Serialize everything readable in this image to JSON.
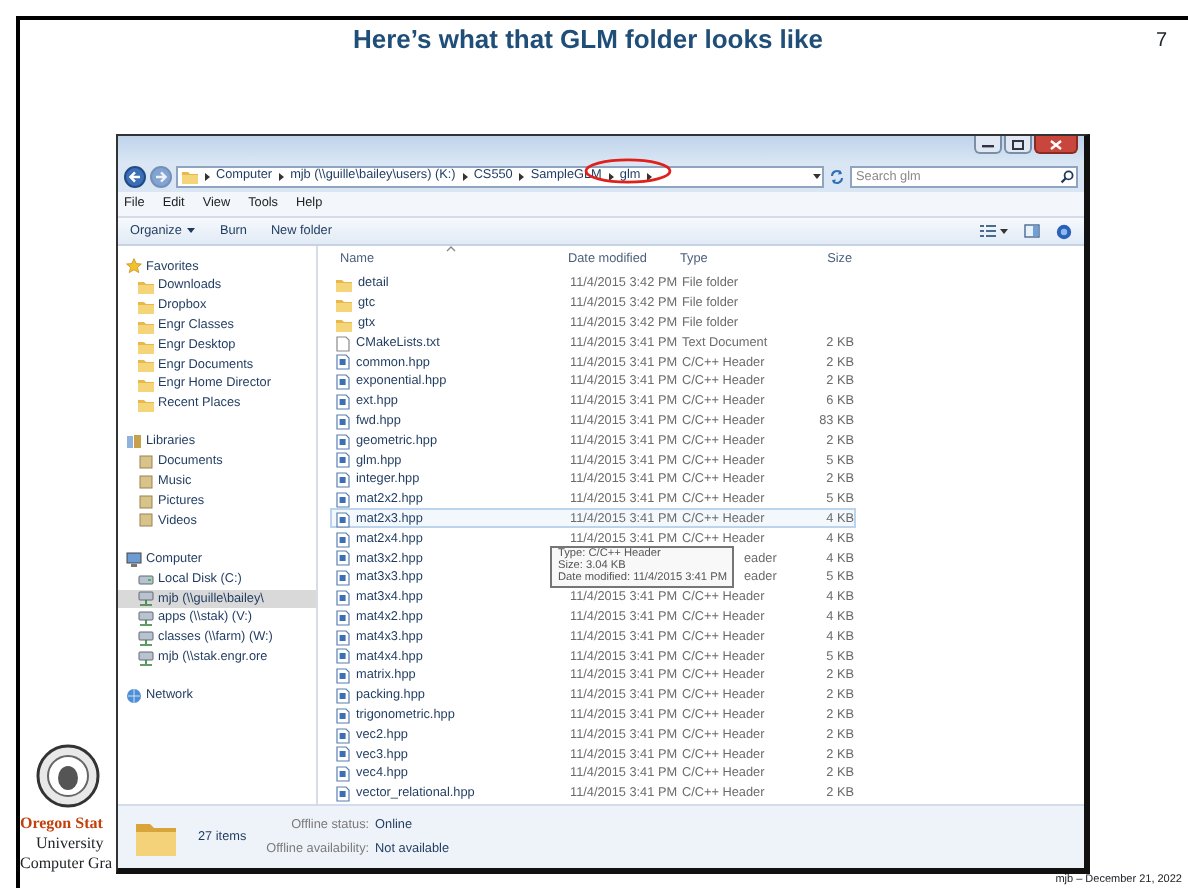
{
  "slide": {
    "title": "Here’s what that GLM folder looks like",
    "page_number": "7",
    "logo_lines": [
      "Oregon Stat",
      "University",
      "Computer Gra"
    ],
    "footer": "mjb – December 21, 2022"
  },
  "explorer": {
    "breadcrumbs": [
      {
        "label": "Computer",
        "circled": false
      },
      {
        "label": "mjb (\\\\guille\\bailey\\users) (K:)",
        "circled": false
      },
      {
        "label": "CS550",
        "circled": false
      },
      {
        "label": "SampleGLM",
        "circled": false
      },
      {
        "label": "glm",
        "circled": true
      }
    ],
    "search": {
      "placeholder": "Search glm"
    },
    "menu": [
      "File",
      "Edit",
      "View",
      "Tools",
      "Help"
    ],
    "toolbar": [
      {
        "label": "Organize",
        "dropdown": true
      },
      {
        "label": "Burn",
        "dropdown": false
      },
      {
        "label": "New folder",
        "dropdown": false
      }
    ],
    "sidebar": [
      {
        "label": "Favorites",
        "kind": "favorites",
        "items": [
          {
            "label": "Downloads",
            "kind": "folder",
            "selected": false
          },
          {
            "label": "Dropbox",
            "kind": "folder",
            "selected": false
          },
          {
            "label": "Engr Classes",
            "kind": "folder",
            "selected": false
          },
          {
            "label": "Engr Desktop",
            "kind": "folder",
            "selected": false
          },
          {
            "label": "Engr Documents",
            "kind": "folder",
            "selected": false
          },
          {
            "label": "Engr Home Director",
            "kind": "folder",
            "selected": false
          },
          {
            "label": "Recent Places",
            "kind": "folder",
            "selected": false
          }
        ]
      },
      {
        "label": "Libraries",
        "kind": "libraries",
        "items": [
          {
            "label": "Documents",
            "kind": "library",
            "selected": false
          },
          {
            "label": "Music",
            "kind": "library",
            "selected": false
          },
          {
            "label": "Pictures",
            "kind": "library",
            "selected": false
          },
          {
            "label": "Videos",
            "kind": "library",
            "selected": false
          }
        ]
      },
      {
        "label": "Computer",
        "kind": "computer",
        "items": [
          {
            "label": "Local Disk (C:)",
            "kind": "drive",
            "selected": false
          },
          {
            "label": "mjb (\\\\guille\\bailey\\",
            "kind": "netdrive",
            "selected": true
          },
          {
            "label": "apps (\\\\stak) (V:)",
            "kind": "netdrive",
            "selected": false
          },
          {
            "label": "classes (\\\\farm) (W:)",
            "kind": "netdrive",
            "selected": false
          },
          {
            "label": "mjb (\\\\stak.engr.ore",
            "kind": "netdrive",
            "selected": false
          }
        ]
      },
      {
        "label": "Network",
        "kind": "network"
      }
    ],
    "columns": [
      "Name",
      "Date modified",
      "Type",
      "Size"
    ],
    "files": [
      {
        "name": "detail",
        "date": "11/4/2015 3:42 PM",
        "type": "File folder",
        "kind": "folder",
        "hovered": false
      },
      {
        "name": "gtc",
        "date": "11/4/2015 3:42 PM",
        "type": "File folder",
        "kind": "folder",
        "hovered": false
      },
      {
        "name": "gtx",
        "date": "11/4/2015 3:42 PM",
        "type": "File folder",
        "kind": "folder",
        "hovered": false
      },
      {
        "name": "CMakeLists.txt",
        "date": "11/4/2015 3:41 PM",
        "type": "Text Document",
        "size": "2 KB",
        "kind": "text",
        "hovered": false
      },
      {
        "name": "common.hpp",
        "date": "11/4/2015 3:41 PM",
        "type": "C/C++ Header",
        "size": "2 KB",
        "kind": "header",
        "hovered": false
      },
      {
        "name": "exponential.hpp",
        "date": "11/4/2015 3:41 PM",
        "type": "C/C++ Header",
        "size": "2 KB",
        "kind": "header",
        "hovered": false
      },
      {
        "name": "ext.hpp",
        "date": "11/4/2015 3:41 PM",
        "type": "C/C++ Header",
        "size": "6 KB",
        "kind": "header",
        "hovered": false
      },
      {
        "name": "fwd.hpp",
        "date": "11/4/2015 3:41 PM",
        "type": "C/C++ Header",
        "size": "83 KB",
        "kind": "header",
        "hovered": false
      },
      {
        "name": "geometric.hpp",
        "date": "11/4/2015 3:41 PM",
        "type": "C/C++ Header",
        "size": "2 KB",
        "kind": "header",
        "hovered": false
      },
      {
        "name": "glm.hpp",
        "date": "11/4/2015 3:41 PM",
        "type": "C/C++ Header",
        "size": "5 KB",
        "kind": "header",
        "hovered": false
      },
      {
        "name": "integer.hpp",
        "date": "11/4/2015 3:41 PM",
        "type": "C/C++ Header",
        "size": "2 KB",
        "kind": "header",
        "hovered": false
      },
      {
        "name": "mat2x2.hpp",
        "date": "11/4/2015 3:41 PM",
        "type": "C/C++ Header",
        "size": "5 KB",
        "kind": "header",
        "hovered": false
      },
      {
        "name": "mat2x3.hpp",
        "date": "11/4/2015 3:41 PM",
        "type": "C/C++ Header",
        "size": "4 KB",
        "kind": "header",
        "hovered": true
      },
      {
        "name": "mat2x4.hpp",
        "date": "11/4/2015 3:41 PM",
        "type": "C/C++ Header",
        "size": "4 KB",
        "kind": "header",
        "hovered": false
      },
      {
        "name": "mat3x2.hpp",
        "type": "eader",
        "size": "4 KB",
        "kind": "header",
        "hovered": false
      },
      {
        "name": "mat3x3.hpp",
        "type": "eader",
        "size": "5 KB",
        "kind": "header",
        "hovered": false
      },
      {
        "name": "mat3x4.hpp",
        "date": "11/4/2015 3:41 PM",
        "type": "C/C++ Header",
        "size": "4 KB",
        "kind": "header",
        "hovered": false
      },
      {
        "name": "mat4x2.hpp",
        "date": "11/4/2015 3:41 PM",
        "type": "C/C++ Header",
        "size": "4 KB",
        "kind": "header",
        "hovered": false
      },
      {
        "name": "mat4x3.hpp",
        "date": "11/4/2015 3:41 PM",
        "type": "C/C++ Header",
        "size": "4 KB",
        "kind": "header",
        "hovered": false
      },
      {
        "name": "mat4x4.hpp",
        "date": "11/4/2015 3:41 PM",
        "type": "C/C++ Header",
        "size": "5 KB",
        "kind": "header",
        "hovered": false
      },
      {
        "name": "matrix.hpp",
        "date": "11/4/2015 3:41 PM",
        "type": "C/C++ Header",
        "size": "2 KB",
        "kind": "header",
        "hovered": false
      },
      {
        "name": "packing.hpp",
        "date": "11/4/2015 3:41 PM",
        "type": "C/C++ Header",
        "size": "2 KB",
        "kind": "header",
        "hovered": false
      },
      {
        "name": "trigonometric.hpp",
        "date": "11/4/2015 3:41 PM",
        "type": "C/C++ Header",
        "size": "2 KB",
        "kind": "header",
        "hovered": false
      },
      {
        "name": "vec2.hpp",
        "date": "11/4/2015 3:41 PM",
        "type": "C/C++ Header",
        "size": "2 KB",
        "kind": "header",
        "hovered": false
      },
      {
        "name": "vec3.hpp",
        "date": "11/4/2015 3:41 PM",
        "type": "C/C++ Header",
        "size": "2 KB",
        "kind": "header",
        "hovered": false
      },
      {
        "name": "vec4.hpp",
        "date": "11/4/2015 3:41 PM",
        "type": "C/C++ Header",
        "size": "2 KB",
        "kind": "header",
        "hovered": false
      },
      {
        "name": "vector_relational.hpp",
        "date": "11/4/2015 3:41 PM",
        "type": "C/C++ Header",
        "size": "2 KB",
        "kind": "header",
        "hovered": false
      }
    ],
    "tooltip": [
      "Type: C/C++ Header",
      "Size: 3.04 KB",
      "Date modified: 11/4/2015 3:41 PM"
    ],
    "status": {
      "count": "27 items",
      "details": [
        {
          "label": "Offline status:",
          "value": "Online"
        },
        {
          "label": "Offline availability:",
          "value": "Not available"
        }
      ]
    }
  }
}
